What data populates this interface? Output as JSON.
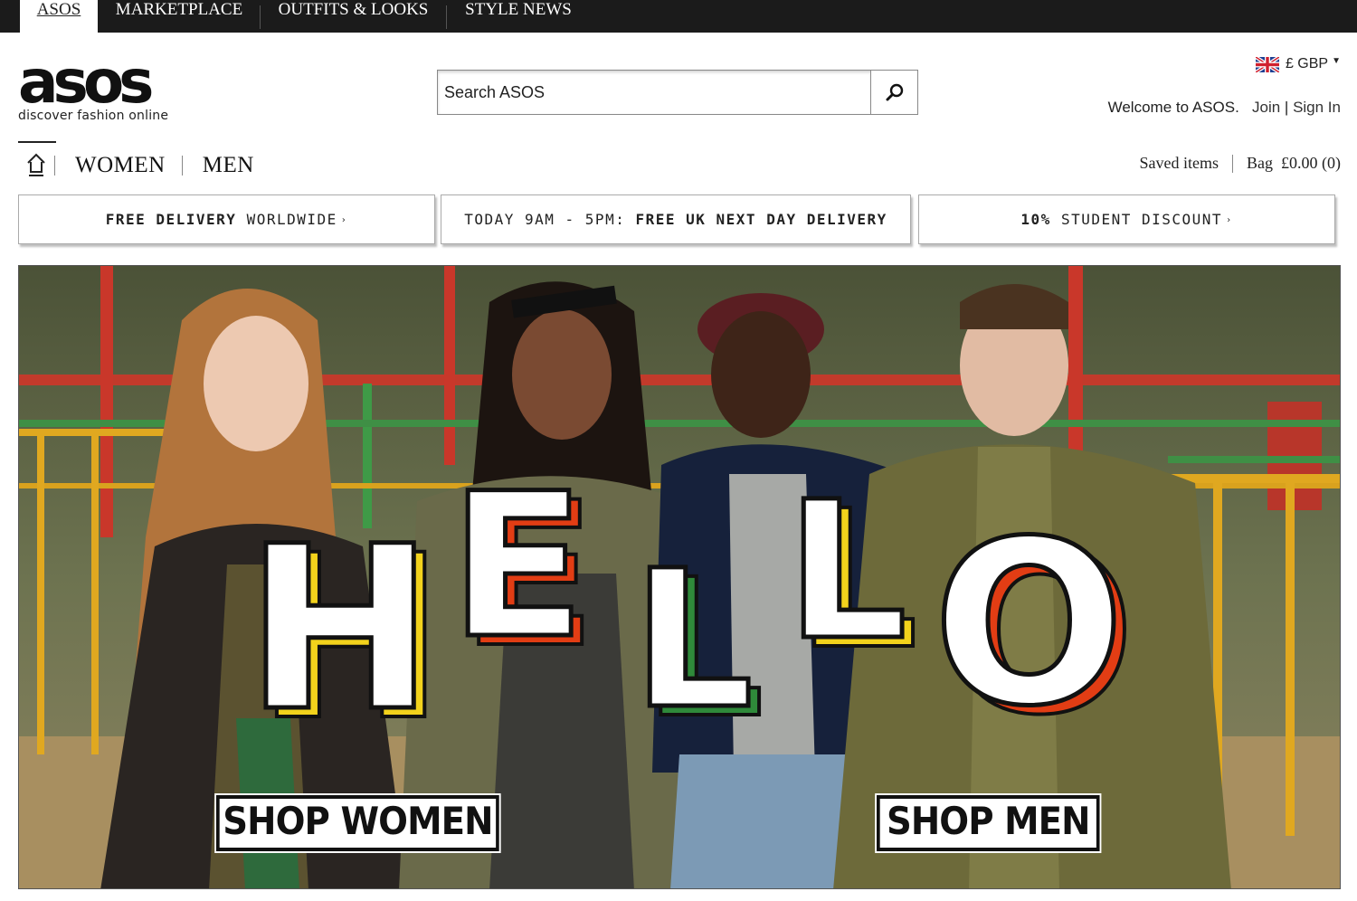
{
  "topbar": {
    "tabs": [
      {
        "label": "ASOS",
        "active": true
      },
      {
        "label": "MARKETPLACE",
        "active": false
      },
      {
        "label": "OUTFITS & LOOKS",
        "active": false
      },
      {
        "label": "STYLE NEWS",
        "active": false
      }
    ]
  },
  "logo": {
    "word": "asos",
    "tagline": "discover fashion online"
  },
  "search": {
    "placeholder": "Search ASOS",
    "icon": "search-icon"
  },
  "currency": {
    "symbol": "£",
    "code": "GBP",
    "flag": "uk-flag-icon"
  },
  "account": {
    "welcome": "Welcome to ASOS.",
    "join": "Join",
    "sign_in": "Sign In",
    "separator": "|"
  },
  "gender_nav": {
    "home_icon": "home-icon",
    "women": "WOMEN",
    "men": "MEN"
  },
  "right_nav": {
    "saved_items": "Saved items",
    "bag_label": "Bag",
    "bag_amount": "£0.00",
    "bag_count": "(0)"
  },
  "promos": [
    {
      "bold": "FREE DELIVERY",
      "normal": "WORLDWIDE",
      "chevron": "›"
    },
    {
      "normal": "TODAY 9AM - 5PM:",
      "bold": "FREE UK NEXT DAY DELIVERY"
    },
    {
      "bold": "10%",
      "normal": "STUDENT DISCOUNT",
      "chevron": "›"
    }
  ],
  "hero": {
    "headline_letters": [
      "H",
      "E",
      "L",
      "L",
      "O"
    ],
    "shop_women": "SHOP WOMEN",
    "shop_men": "SHOP MEN"
  },
  "colors": {
    "topbar": "#1b1b1b",
    "accent_red": "#e23d14",
    "accent_yellow": "#f2d21c",
    "accent_green": "#2f8a3a"
  }
}
